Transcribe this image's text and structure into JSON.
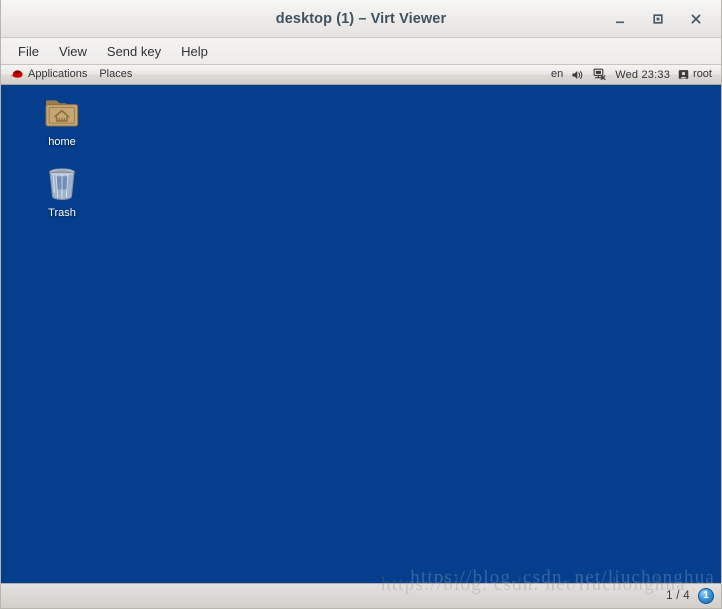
{
  "window": {
    "title": "desktop (1) – Virt Viewer",
    "controls": {
      "minimize_label": "Minimize",
      "maximize_label": "Maximize",
      "close_label": "Close"
    }
  },
  "menubar": {
    "items": [
      {
        "label": "File"
      },
      {
        "label": "View"
      },
      {
        "label": "Send key"
      },
      {
        "label": "Help"
      }
    ]
  },
  "guest": {
    "background_color": "#043e8c",
    "panel": {
      "left": [
        {
          "label": "Applications",
          "icon": "redhat-shadowman-icon"
        },
        {
          "label": "Places",
          "icon": ""
        }
      ],
      "right": {
        "keyboard_layout": "en",
        "volume_icon": "volume-icon",
        "network_icon": "network-disconnected-icon",
        "clock": "Wed 23:33",
        "user_icon": "user-icon",
        "user": "root"
      }
    },
    "desktop_icons": [
      {
        "label": "home",
        "icon": "home-folder-icon"
      },
      {
        "label": "Trash",
        "icon": "trash-can-icon"
      }
    ],
    "watermark": "https://blog. csdn. net/liuchonghua"
  },
  "statusbar": {
    "page_indicator": "1 / 4",
    "badge": "1",
    "badge_color": "#3d97e0",
    "watermark": "https://blog. csdn. net/liuchonghua"
  }
}
